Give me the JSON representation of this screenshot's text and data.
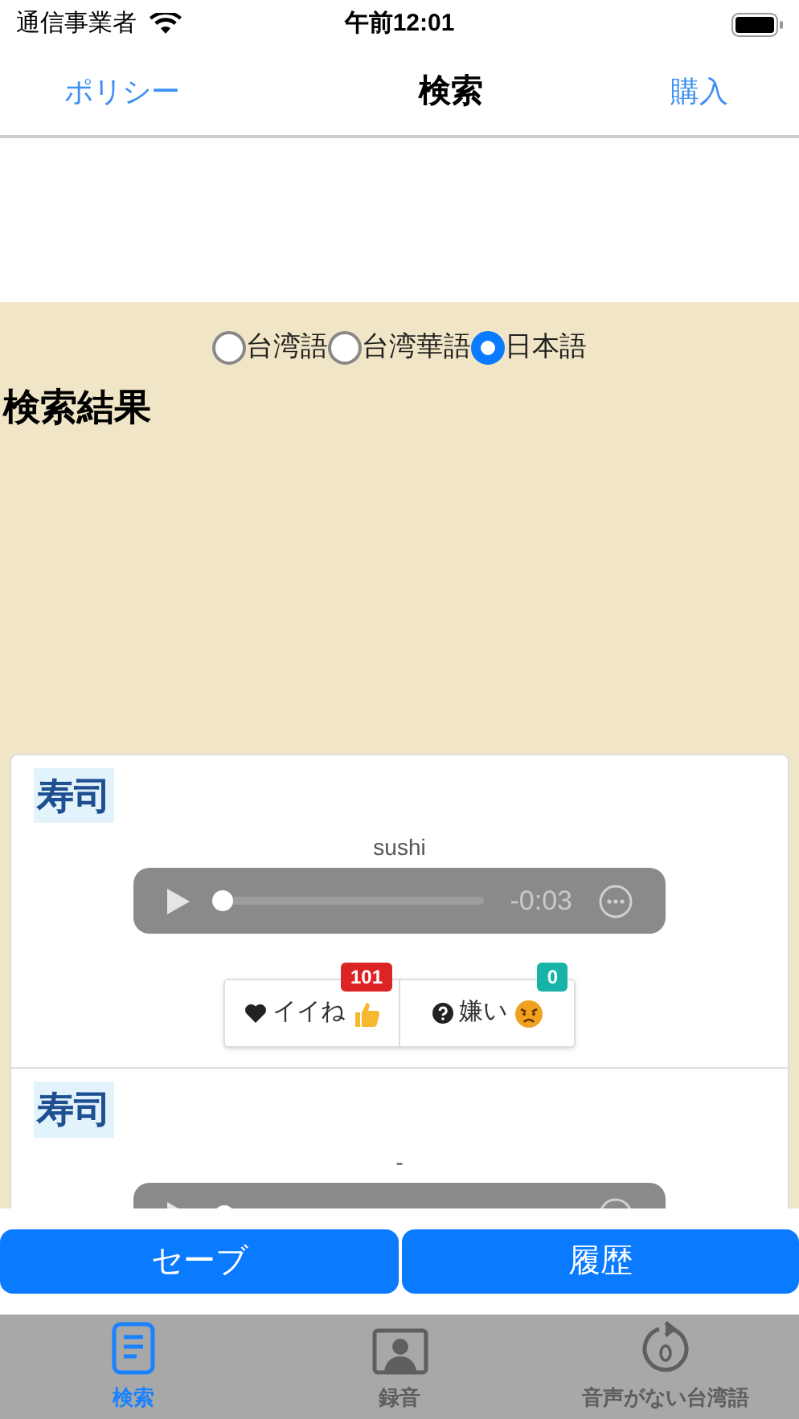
{
  "status_bar": {
    "carrier": "通信事業者",
    "time": "午前12:01"
  },
  "nav": {
    "left": "ポリシー",
    "title": "検索",
    "right": "購入"
  },
  "languages": [
    {
      "label": "台湾語",
      "selected": false
    },
    {
      "label": "台湾華語",
      "selected": false
    },
    {
      "label": "日本語",
      "selected": true
    }
  ],
  "results_heading": "検索結果",
  "results": [
    {
      "word": "寿司",
      "reading": "sushi",
      "player": {
        "level": 0.02,
        "time": "-0:03"
      },
      "likes": {
        "label": "イイね",
        "count": "101"
      },
      "dislikes": {
        "label": "嫌い",
        "count": "0"
      }
    },
    {
      "word": "寿司",
      "reading": "-",
      "player": {
        "level": 0.02
      }
    }
  ],
  "buttons": [
    "セーブ",
    "履歴"
  ],
  "tabs": [
    {
      "label": "検索",
      "selected": true
    },
    {
      "label": "録音",
      "selected": false
    },
    {
      "label": "音声がない台湾語",
      "selected": false
    }
  ]
}
